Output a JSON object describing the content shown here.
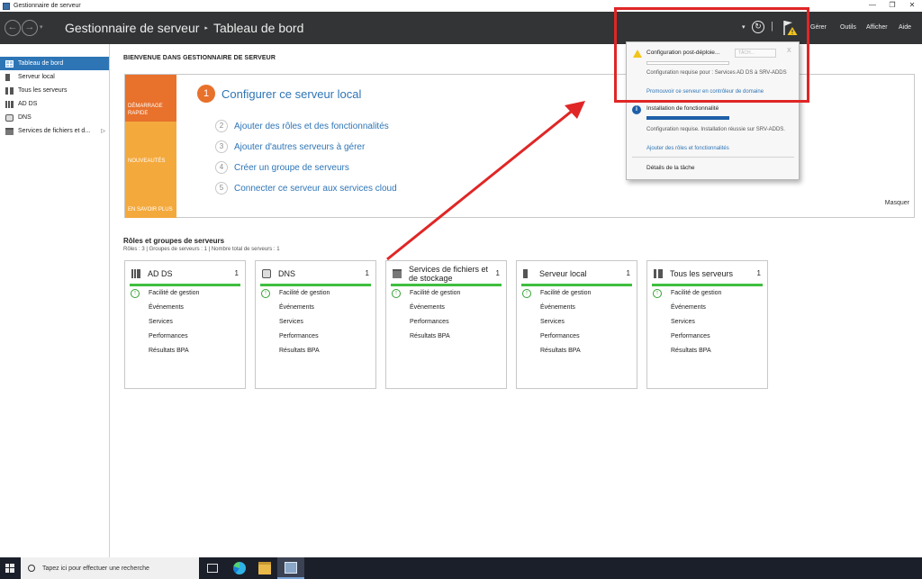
{
  "window": {
    "title": "Gestionnaire de serveur",
    "controls": {
      "minimize": "—",
      "maximize": "❐",
      "close": "✕"
    }
  },
  "header": {
    "back_glyph": "←",
    "forward_glyph": "→",
    "dropdown_glyph": "▾",
    "breadcrumb": {
      "root": "Gestionnaire de serveur",
      "separator": "▸",
      "current": "Tableau de bord"
    },
    "refresh_glyph": "↻",
    "pipe": "|",
    "menu": [
      "Gérer",
      "Outils",
      "Afficher",
      "Aide"
    ]
  },
  "sidebar": {
    "items": [
      {
        "label": "Tableau de bord",
        "icon": "dashboard-icon",
        "active": true
      },
      {
        "label": "Serveur local",
        "icon": "server-icon",
        "active": false
      },
      {
        "label": "Tous les serveurs",
        "icon": "servers-icon",
        "active": false
      },
      {
        "label": "AD DS",
        "icon": "ad-ds-icon",
        "active": false
      },
      {
        "label": "DNS",
        "icon": "dns-icon",
        "active": false
      },
      {
        "label": "Services de fichiers et d...",
        "icon": "file-services-icon",
        "active": false,
        "chevron": "▷"
      }
    ]
  },
  "welcome": {
    "title": "BIENVENUE DANS GESTIONNAIRE DE SERVEUR",
    "tabs": [
      "DÉMARRAGE RAPIDE",
      "NOUVEAUTÉS",
      "EN SAVOIR PLUS"
    ],
    "steps": [
      {
        "num": "1",
        "label": "Configurer ce serveur local"
      },
      {
        "num": "2",
        "label": "Ajouter des rôles et des fonctionnalités"
      },
      {
        "num": "3",
        "label": "Ajouter d'autres serveurs à gérer"
      },
      {
        "num": "4",
        "label": "Créer un groupe de serveurs"
      },
      {
        "num": "5",
        "label": "Connecter ce serveur aux services cloud"
      }
    ],
    "hide": "Masquer"
  },
  "roles": {
    "title": "Rôles et groupes de serveurs",
    "summary": "Rôles : 3   |   Groupes de serveurs : 1   |   Nombre total de serveurs : 1",
    "tiles": [
      {
        "title": "AD DS",
        "count": "1",
        "rows": [
          "Facilité de gestion",
          "Événements",
          "Services",
          "Performances",
          "Résultats BPA"
        ]
      },
      {
        "title": "DNS",
        "count": "1",
        "rows": [
          "Facilité de gestion",
          "Événements",
          "Services",
          "Performances",
          "Résultats BPA"
        ]
      },
      {
        "title": "Services de fichiers et de stockage",
        "count": "1",
        "rows": [
          "Facilité de gestion",
          "Événements",
          "Performances",
          "Résultats BPA"
        ]
      },
      {
        "title": "Serveur local",
        "count": "1",
        "rows": [
          "Facilité de gestion",
          "Événements",
          "Services",
          "Performances",
          "Résultats BPA"
        ]
      },
      {
        "title": "Tous les serveurs",
        "count": "1",
        "rows": [
          "Facilité de gestion",
          "Événements",
          "Services",
          "Performances",
          "Résultats BPA"
        ]
      }
    ]
  },
  "notifications": {
    "post_deploy": {
      "title": "Configuration post-déploie...",
      "select": "TÂCH...",
      "close": "X",
      "text": "Configuration requise pour : Services AD DS à SRV-ADDS",
      "link": "Promouvoir ce serveur en contrôleur de domaine"
    },
    "install": {
      "title": "Installation de fonctionnalité",
      "text": "Configuration requise. Installation réussie sur SRV-ADDS.",
      "link": "Ajouter des rôles et fonctionnalités"
    },
    "task_details": "Détails de la tâche"
  },
  "taskbar": {
    "search_placeholder": "Tapez ici pour effectuer une recherche"
  },
  "colors": {
    "accent": "#2e75b6",
    "header": "#333436",
    "quickstart_orange": "#e8712b",
    "quickstart_amber": "#f4a93c",
    "tile_status": "#3fbf3f",
    "annotation": "#e02626"
  }
}
